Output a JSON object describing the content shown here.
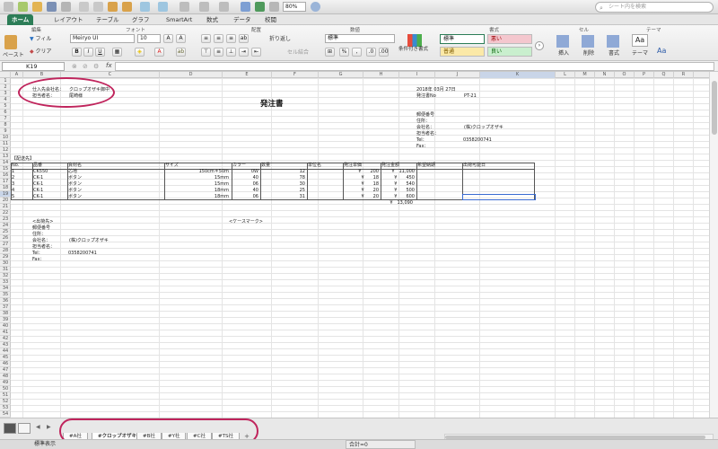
{
  "toolbar": {
    "zoom": "80%",
    "search_placeholder": "シート内を検索"
  },
  "ribbon_tabs": [
    "ホーム",
    "レイアウト",
    "テーブル",
    "グラフ",
    "SmartArt",
    "数式",
    "データ",
    "校閲"
  ],
  "ribbon": {
    "groups": [
      "編集",
      "フォント",
      "配置",
      "数値",
      "書式",
      "セル",
      "テーマ"
    ],
    "fill_label": "フィル",
    "clear_label": "クリア",
    "paste_label": "ペースト",
    "font_name": "Meiryo UI",
    "font_size": "10",
    "wrap_label": "折り返し",
    "merge_label": "セル結合",
    "number_format": "標準",
    "cond_format_label": "条件付き書式",
    "styles": {
      "normal": "標準",
      "bad": "悪い",
      "neutral": "普通",
      "good": "良い"
    },
    "insert_label": "挿入",
    "delete_label": "削除",
    "format_label": "書式",
    "theme_label": "テーマ",
    "aa_label": "Aa"
  },
  "formula_bar": {
    "name_box": "K19",
    "formula": ""
  },
  "columns": [
    "A",
    "B",
    "C",
    "D",
    "E",
    "F",
    "G",
    "H",
    "I",
    "J",
    "K",
    "L",
    "M",
    "N",
    "O",
    "P",
    "Q",
    "R"
  ],
  "selected_column": "K",
  "selected_row": 19,
  "sheet": {
    "supplier_label": "仕入先会社名：",
    "supplier_value": "クロップオザキ御中",
    "contact_label": "担当者名：",
    "contact_value": "尾崎様",
    "title": "発注書",
    "date": "2018年 03月 27日",
    "order_no_label": "発注書No",
    "order_no": "PT-21",
    "sender": {
      "postal_label": "郵便番号",
      "address_label": "住所：",
      "company_label": "会社名：",
      "company_value": "(株)クロップオザキ",
      "person_label": "担当者名：",
      "tel_label": "Tel：",
      "tel_value": "0358200741",
      "fax_label": "Fax："
    },
    "ship_to_header": "【配送先】",
    "table_headers": [
      "No.",
      "品番",
      "資材名",
      "サイズ",
      "カラー",
      "数量",
      "単位名",
      "発注単価",
      "発注金額",
      "希望納期",
      "出荷可能日"
    ],
    "rows": [
      {
        "no": "1",
        "code": "CK550",
        "name": "芯地",
        "size": "150cm＊50m",
        "color": "0W",
        "qty": "12",
        "price": "¥　　200",
        "amount": "¥　11,000"
      },
      {
        "no": "2",
        "code": "CK-1",
        "name": "ボタン",
        "size": "15mm",
        "color": "40",
        "qty": "78",
        "price": "¥　　18",
        "amount": "¥　　450"
      },
      {
        "no": "3",
        "code": "CK-1",
        "name": "ボタン",
        "size": "15mm",
        "color": "06",
        "qty": "30",
        "price": "¥　　18",
        "amount": "¥　　540"
      },
      {
        "no": "4",
        "code": "CK-1",
        "name": "ボタン",
        "size": "18mm",
        "color": "40",
        "qty": "25",
        "price": "¥　　20",
        "amount": "¥　　500"
      },
      {
        "no": "5",
        "code": "CK-1",
        "name": "ボタン",
        "size": "18mm",
        "color": "06",
        "qty": "31",
        "price": "¥　　20",
        "amount": "¥　　600"
      }
    ],
    "total": "¥　13,090",
    "ship_from_header": "<出荷先>",
    "case_mark_label": "<ケースマーク>",
    "ship_from": {
      "postal_label": "郵便番号",
      "address_label": "住所：",
      "company_label": "会社名：",
      "company_value": "(株)クロップオザキ",
      "person_label": "担当者名：",
      "tel_label": "Tel：",
      "tel_value": "0358200741",
      "fax_label": "Fax："
    }
  },
  "sheet_tabs": [
    "#A社",
    "#クロップオザキ",
    "#B社",
    "#Y社",
    "#C社",
    "#TS社"
  ],
  "active_tab_index": 1,
  "status_bar": {
    "view": "標準表示",
    "sum": "合計=0"
  },
  "accent_color": "#2c7d57",
  "highlight_color": "#c0245c"
}
